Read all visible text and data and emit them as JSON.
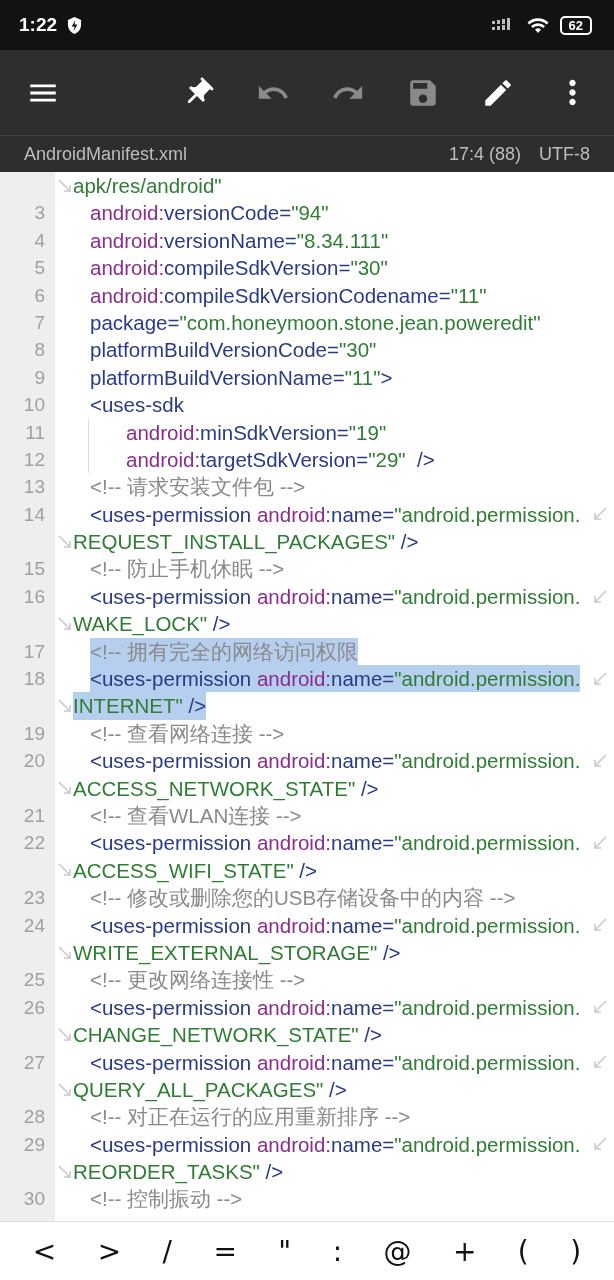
{
  "status_bar": {
    "time": "1:22",
    "battery": "62"
  },
  "toolbar": [
    {
      "kind": "menu",
      "disabled": false
    },
    {
      "kind": "pin",
      "disabled": false
    },
    {
      "kind": "undo",
      "disabled": true
    },
    {
      "kind": "redo",
      "disabled": true
    },
    {
      "kind": "save",
      "disabled": true
    },
    {
      "kind": "edit",
      "disabled": false
    },
    {
      "kind": "more",
      "disabled": false
    }
  ],
  "info_bar": {
    "file": "AndroidManifest.xml",
    "position": "17:4 (88)",
    "encoding": "UTF-8"
  },
  "lines": [
    {
      "selected": false,
      "wrap": [
        {
          "kind": "value",
          "text": "apk/res/android\""
        }
      ]
    },
    {
      "number": "3",
      "selected": false,
      "tokens": [
        {
          "kind": "ns",
          "text": "android:"
        },
        {
          "kind": "attr",
          "text": "versionCode="
        },
        {
          "kind": "value",
          "text": "\"94\""
        }
      ]
    },
    {
      "number": "4",
      "selected": false,
      "tokens": [
        {
          "kind": "ns",
          "text": "android:"
        },
        {
          "kind": "attr",
          "text": "versionName="
        },
        {
          "kind": "value",
          "text": "\"8.34.111\""
        }
      ]
    },
    {
      "number": "5",
      "selected": false,
      "tokens": [
        {
          "kind": "ns",
          "text": "android:"
        },
        {
          "kind": "attr",
          "text": "compileSdkVersion="
        },
        {
          "kind": "value",
          "text": "\"30\""
        }
      ]
    },
    {
      "number": "6",
      "selected": false,
      "tokens": [
        {
          "kind": "ns",
          "text": "android:"
        },
        {
          "kind": "attr",
          "text": "compileSdkVersionCodename="
        },
        {
          "kind": "value",
          "text": "\"11\""
        }
      ]
    },
    {
      "number": "7",
      "selected": false,
      "tokens": [
        {
          "kind": "attr",
          "text": "package="
        },
        {
          "kind": "value",
          "text": "\"com.honeymoon.stone.jean.poweredit\""
        }
      ]
    },
    {
      "number": "8",
      "selected": false,
      "tokens": [
        {
          "kind": "attr",
          "text": "platformBuildVersionCode="
        },
        {
          "kind": "value",
          "text": "\"30\""
        }
      ]
    },
    {
      "number": "9",
      "selected": false,
      "tokens": [
        {
          "kind": "attr",
          "text": "platformBuildVersionName="
        },
        {
          "kind": "value",
          "text": "\"11\""
        },
        {
          "kind": "tag",
          "text": ">"
        }
      ]
    },
    {
      "number": "10",
      "selected": false,
      "tokens": [
        {
          "kind": "tag",
          "text": "<uses-sdk"
        }
      ],
      "children": [
        {
          "number": "11",
          "selected": false,
          "tokens": [
            {
              "kind": "ns",
              "text": "android:"
            },
            {
              "kind": "attr",
              "text": "minSdkVersion="
            },
            {
              "kind": "value",
              "text": "\"19\""
            }
          ]
        },
        {
          "number": "12",
          "selected": false,
          "tokens": [
            {
              "kind": "ns",
              "text": "android:"
            },
            {
              "kind": "attr",
              "text": "targetSdkVersion="
            },
            {
              "kind": "value",
              "text": "\"29\""
            },
            {
              "kind": "tag",
              "text": "  />"
            }
          ]
        }
      ]
    },
    {
      "number": "13",
      "selected": false,
      "tokens": [
        {
          "kind": "comment",
          "text": "<!-- 请求安装文件包 -->"
        }
      ]
    },
    {
      "number": "14",
      "selected": false,
      "tokens": [
        {
          "kind": "tag",
          "text": "<uses-permission "
        },
        {
          "kind": "ns",
          "text": "android:"
        },
        {
          "kind": "attr",
          "text": "name="
        },
        {
          "kind": "value",
          "text": "\"android.permission."
        }
      ],
      "wrap": [
        {
          "kind": "value",
          "text": "REQUEST_INSTALL_PACKAGES\""
        },
        {
          "kind": "tag",
          "text": " />"
        }
      ]
    },
    {
      "number": "15",
      "selected": false,
      "tokens": [
        {
          "kind": "comment",
          "text": "<!-- 防止手机休眠 -->"
        }
      ]
    },
    {
      "number": "16",
      "selected": false,
      "tokens": [
        {
          "kind": "tag",
          "text": "<uses-permission "
        },
        {
          "kind": "ns",
          "text": "android:"
        },
        {
          "kind": "attr",
          "text": "name="
        },
        {
          "kind": "value",
          "text": "\"android.permission."
        }
      ],
      "wrap": [
        {
          "kind": "value",
          "text": "WAKE_LOCK\""
        },
        {
          "kind": "tag",
          "text": " />"
        }
      ]
    },
    {
      "number": "17",
      "selected": true,
      "tokens": [
        {
          "kind": "comment",
          "text": "<!-- 拥有完全的网络访问权限"
        }
      ]
    },
    {
      "number": "18",
      "selected": true,
      "tokens": [
        {
          "kind": "tag",
          "text": "<uses-permission "
        },
        {
          "kind": "ns",
          "text": "android:"
        },
        {
          "kind": "attr",
          "text": "name="
        },
        {
          "kind": "value",
          "text": "\"android.permission."
        }
      ],
      "wrap": [
        {
          "kind": "value",
          "text": "INTERNET\""
        },
        {
          "kind": "tag",
          "text": " />"
        }
      ]
    },
    {
      "number": "19",
      "selected": false,
      "tokens": [
        {
          "kind": "comment",
          "text": "<!-- 查看网络连接 -->"
        }
      ]
    },
    {
      "number": "20",
      "selected": false,
      "tokens": [
        {
          "kind": "tag",
          "text": "<uses-permission "
        },
        {
          "kind": "ns",
          "text": "android:"
        },
        {
          "kind": "attr",
          "text": "name="
        },
        {
          "kind": "value",
          "text": "\"android.permission."
        }
      ],
      "wrap": [
        {
          "kind": "value",
          "text": "ACCESS_NETWORK_STATE\""
        },
        {
          "kind": "tag",
          "text": " />"
        }
      ]
    },
    {
      "number": "21",
      "selected": false,
      "tokens": [
        {
          "kind": "comment",
          "text": "<!-- 查看WLAN连接 -->"
        }
      ]
    },
    {
      "number": "22",
      "selected": false,
      "tokens": [
        {
          "kind": "tag",
          "text": "<uses-permission "
        },
        {
          "kind": "ns",
          "text": "android:"
        },
        {
          "kind": "attr",
          "text": "name="
        },
        {
          "kind": "value",
          "text": "\"android.permission."
        }
      ],
      "wrap": [
        {
          "kind": "value",
          "text": "ACCESS_WIFI_STATE\""
        },
        {
          "kind": "tag",
          "text": " />"
        }
      ]
    },
    {
      "number": "23",
      "selected": false,
      "tokens": [
        {
          "kind": "comment",
          "text": "<!-- 修改或删除您的USB存储设备中的内容 -->"
        }
      ]
    },
    {
      "number": "24",
      "selected": false,
      "tokens": [
        {
          "kind": "tag",
          "text": "<uses-permission "
        },
        {
          "kind": "ns",
          "text": "android:"
        },
        {
          "kind": "attr",
          "text": "name="
        },
        {
          "kind": "value",
          "text": "\"android.permission."
        }
      ],
      "wrap": [
        {
          "kind": "value",
          "text": "WRITE_EXTERNAL_STORAGE\""
        },
        {
          "kind": "tag",
          "text": " />"
        }
      ]
    },
    {
      "number": "25",
      "selected": false,
      "tokens": [
        {
          "kind": "comment",
          "text": "<!-- 更改网络连接性 -->"
        }
      ]
    },
    {
      "number": "26",
      "selected": false,
      "tokens": [
        {
          "kind": "tag",
          "text": "<uses-permission "
        },
        {
          "kind": "ns",
          "text": "android:"
        },
        {
          "kind": "attr",
          "text": "name="
        },
        {
          "kind": "value",
          "text": "\"android.permission."
        }
      ],
      "wrap": [
        {
          "kind": "value",
          "text": "CHANGE_NETWORK_STATE\""
        },
        {
          "kind": "tag",
          "text": " />"
        }
      ]
    },
    {
      "number": "27",
      "selected": false,
      "tokens": [
        {
          "kind": "tag",
          "text": "<uses-permission "
        },
        {
          "kind": "ns",
          "text": "android:"
        },
        {
          "kind": "attr",
          "text": "name="
        },
        {
          "kind": "value",
          "text": "\"android.permission."
        }
      ],
      "wrap": [
        {
          "kind": "value",
          "text": "QUERY_ALL_PACKAGES\""
        },
        {
          "kind": "tag",
          "text": " />"
        }
      ]
    },
    {
      "number": "28",
      "selected": false,
      "tokens": [
        {
          "kind": "comment",
          "text": "<!-- 对正在运行的应用重新排序 -->"
        }
      ]
    },
    {
      "number": "29",
      "selected": false,
      "tokens": [
        {
          "kind": "tag",
          "text": "<uses-permission "
        },
        {
          "kind": "ns",
          "text": "android:"
        },
        {
          "kind": "attr",
          "text": "name="
        },
        {
          "kind": "value",
          "text": "\"android.permission."
        }
      ],
      "wrap": [
        {
          "kind": "value",
          "text": "REORDER_TASKS\""
        },
        {
          "kind": "tag",
          "text": " />"
        }
      ]
    },
    {
      "number": "30",
      "selected": false,
      "tokens": [
        {
          "kind": "comment",
          "text": "<!-- 控制振动 -->"
        }
      ]
    }
  ],
  "keys": [
    "<",
    ">",
    "/",
    "=",
    "\"",
    ":",
    "@",
    "+",
    "(",
    ")"
  ]
}
